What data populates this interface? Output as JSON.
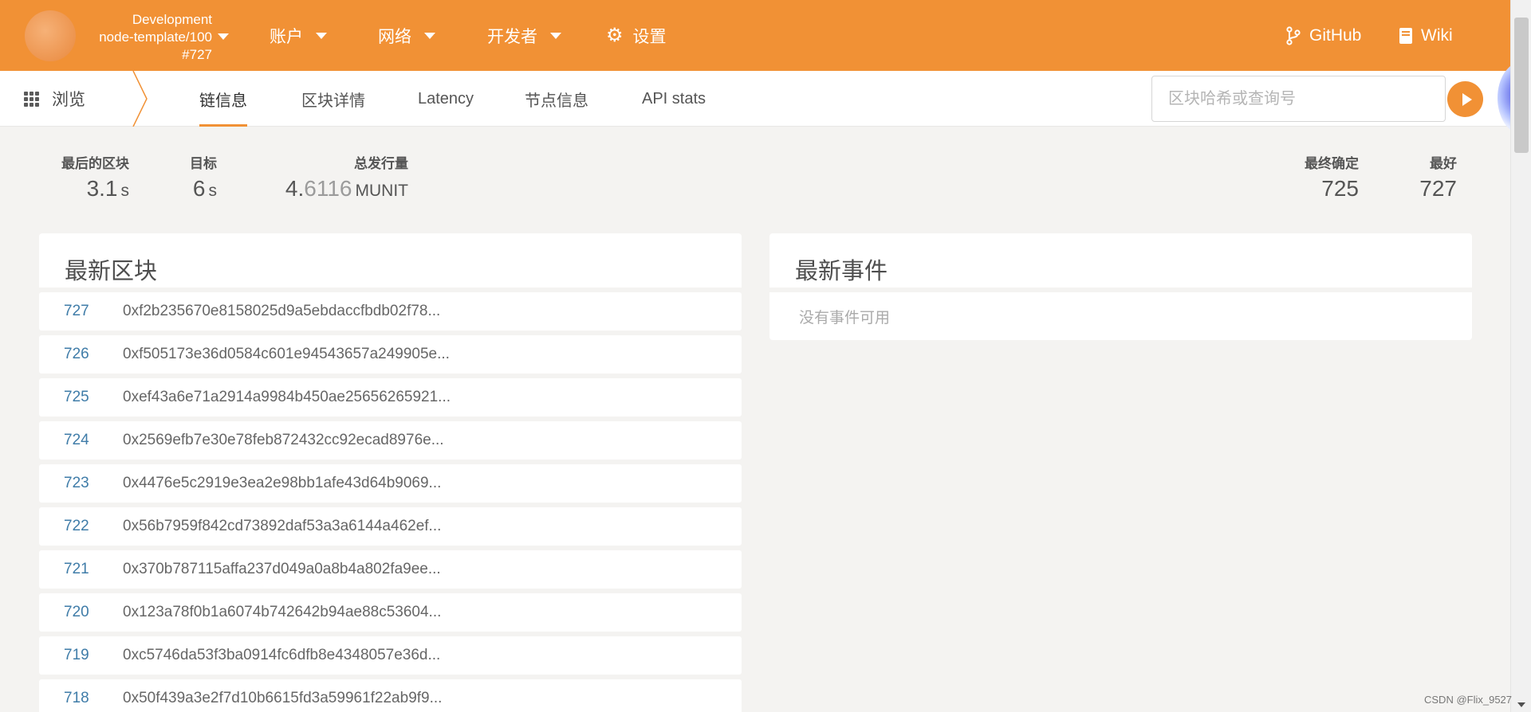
{
  "header": {
    "chain_name": "Development",
    "node_version": "node-template/100",
    "block_number": "#727",
    "menu": [
      {
        "label": "账户"
      },
      {
        "label": "网络"
      },
      {
        "label": "开发者"
      },
      {
        "label": "设置"
      }
    ],
    "github_label": "GitHub",
    "wiki_label": "Wiki"
  },
  "subnav": {
    "browse_label": "浏览",
    "tabs": [
      {
        "label": "链信息",
        "active": true
      },
      {
        "label": "区块详情"
      },
      {
        "label": "Latency"
      },
      {
        "label": "节点信息"
      },
      {
        "label": "API stats"
      }
    ],
    "search_placeholder": "区块哈希或查询号"
  },
  "summary": {
    "last_block": {
      "label": "最后的区块",
      "value": "3.1",
      "unit": "s"
    },
    "target": {
      "label": "目标",
      "value": "6",
      "unit": "s"
    },
    "total_issuance": {
      "label": "总发行量",
      "value_main": "4.",
      "value_dim": "6116",
      "unit": "MUNIT"
    },
    "finalized": {
      "label": "最终确定",
      "value": "725"
    },
    "best": {
      "label": "最好",
      "value": "727"
    }
  },
  "recent_blocks": {
    "title": "最新区块",
    "rows": [
      {
        "number": "727",
        "hash": "0xf2b235670e8158025d9a5ebdaccfbdb02f78..."
      },
      {
        "number": "726",
        "hash": "0xf505173e36d0584c601e94543657a249905e..."
      },
      {
        "number": "725",
        "hash": "0xef43a6e71a2914a9984b450ae25656265921..."
      },
      {
        "number": "724",
        "hash": "0x2569efb7e30e78feb872432cc92ecad8976e..."
      },
      {
        "number": "723",
        "hash": "0x4476e5c2919e3ea2e98bb1afe43d64b9069..."
      },
      {
        "number": "722",
        "hash": "0x56b7959f842cd73892daf53a3a6144a462ef..."
      },
      {
        "number": "721",
        "hash": "0x370b787115affa237d049a0a8b4a802fa9ee..."
      },
      {
        "number": "720",
        "hash": "0x123a78f0b1a6074b742642b94ae88c53604..."
      },
      {
        "number": "719",
        "hash": "0xc5746da53f3ba0914fc6dfb8e4348057e36d..."
      },
      {
        "number": "718",
        "hash": "0x50f439a3e2f7d10b6615fd3a59961f22ab9f9..."
      }
    ]
  },
  "recent_events": {
    "title": "最新事件",
    "empty_text": "没有事件可用"
  },
  "watermark": "CSDN @Flix_9527",
  "colors": {
    "accent": "#f19135",
    "link": "#3f7ca8",
    "background": "#f4f3f1"
  }
}
